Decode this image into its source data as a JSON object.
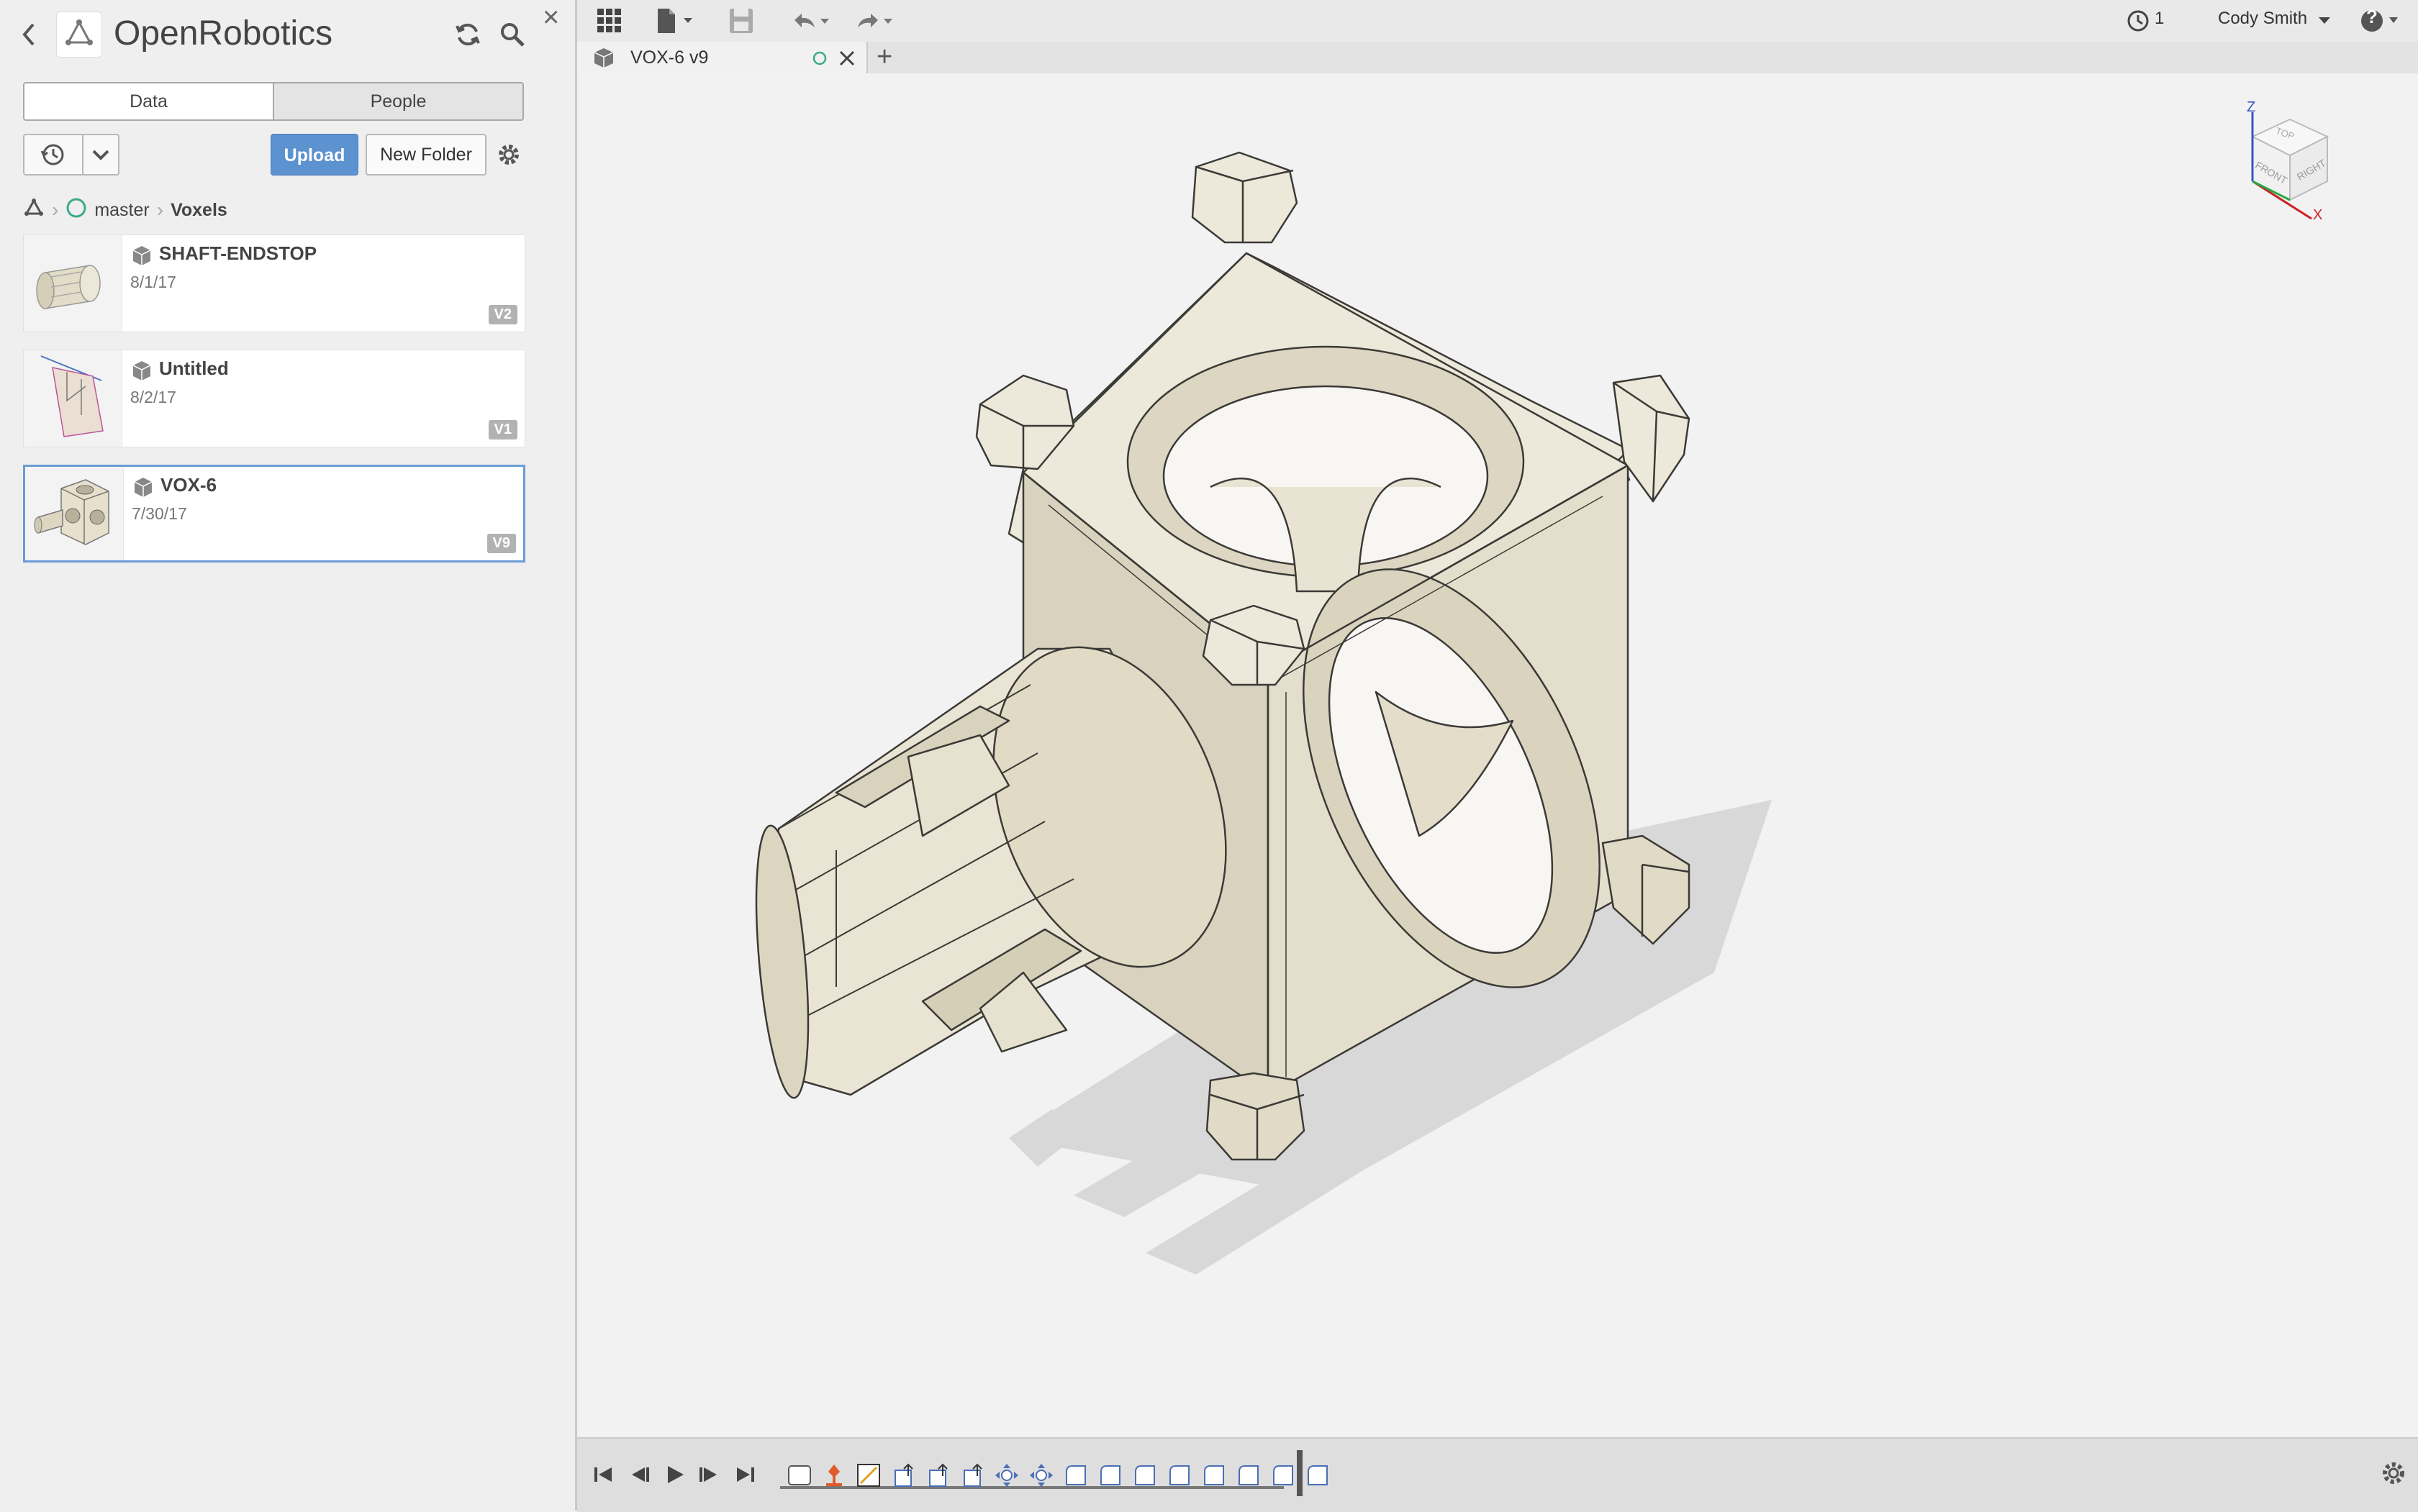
{
  "panel": {
    "project_title": "OpenRobotics",
    "tabs": [
      {
        "label": "Data",
        "active": true
      },
      {
        "label": "People",
        "active": false
      }
    ],
    "upload_label": "Upload",
    "new_folder_label": "New Folder",
    "breadcrumb": {
      "root_icon": "hub-icon",
      "branch": "master",
      "folder": "Voxels"
    },
    "files": [
      {
        "name": "SHAFT-ENDSTOP",
        "date": "8/1/17",
        "version": "V2",
        "selected": false
      },
      {
        "name": "Untitled",
        "date": "8/2/17",
        "version": "V1",
        "selected": false
      },
      {
        "name": "VOX-6",
        "date": "7/30/17",
        "version": "V9",
        "selected": true
      }
    ]
  },
  "toolbar": {
    "job_count": "1",
    "user_name": "Cody Smith",
    "help_symbol": "?"
  },
  "document_tab": {
    "title": "VOX-6 v9",
    "new_tab_symbol": "+"
  },
  "viewcube": {
    "faces": [
      "TOP",
      "FRONT",
      "RIGHT"
    ],
    "axes": [
      "Z",
      "X"
    ]
  },
  "colors": {
    "model_fill": "#e9e5d6",
    "model_shade": "#cfc9b3",
    "accent_blue": "#5c92cf",
    "viewport_bg": "#f2f2f2"
  },
  "timeline": {
    "features": [
      "sketch",
      "extrude",
      "extrude",
      "extrude",
      "extrude",
      "extrude",
      "move",
      "move",
      "fillet",
      "fillet",
      "fillet",
      "fillet",
      "fillet",
      "fillet",
      "fillet",
      "fillet"
    ]
  }
}
